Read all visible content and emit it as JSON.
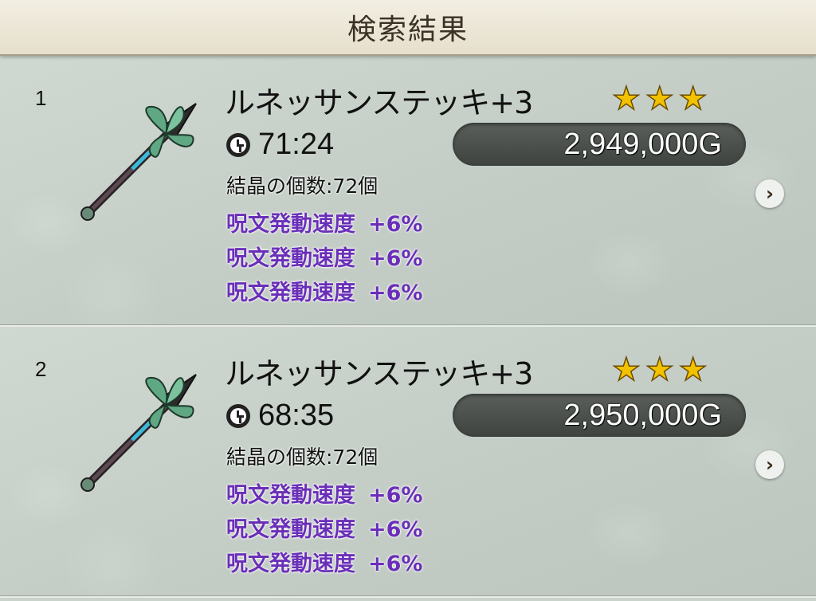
{
  "header": {
    "title": "検索結果"
  },
  "results": [
    {
      "rank": "1",
      "name": "ルネッサンステッキ+3",
      "stars": 3,
      "time_left": "71:24",
      "price": "2,949,000G",
      "crystal_count": "結晶の個数:72個",
      "stats": [
        {
          "label": "呪文発動速度",
          "value": "+6%"
        },
        {
          "label": "呪文発動速度",
          "value": "+6%"
        },
        {
          "label": "呪文発動速度",
          "value": "+6%"
        }
      ]
    },
    {
      "rank": "2",
      "name": "ルネッサンステッキ+3",
      "stars": 3,
      "time_left": "68:35",
      "price": "2,950,000G",
      "crystal_count": "結晶の個数:72個",
      "stats": [
        {
          "label": "呪文発動速度",
          "value": "+6%"
        },
        {
          "label": "呪文発動速度",
          "value": "+6%"
        },
        {
          "label": "呪文発動速度",
          "value": "+6%"
        }
      ]
    }
  ],
  "icons": {
    "star": "star-icon",
    "clock": "clock-icon",
    "chevron": "chevron-right-icon",
    "weapon": "staff-weapon-icon"
  },
  "colors": {
    "stat_text": "#6a2fb8",
    "star": "#f2c200",
    "price_pill": "#464b47"
  }
}
